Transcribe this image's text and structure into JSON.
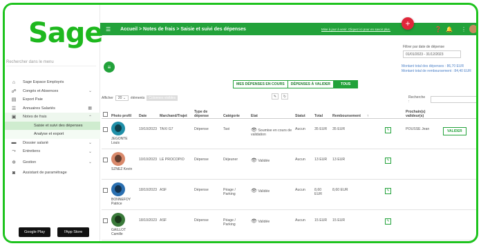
{
  "logo": "Sage",
  "sidebar": {
    "search_placeholder": "Rechercher dans le menu",
    "items": [
      {
        "label": "Sage Espace Employés",
        "icon": "⌂"
      },
      {
        "label": "Congés et Absences",
        "icon": "☍",
        "chev": "⌄"
      },
      {
        "label": "Export Paie",
        "icon": "▤"
      },
      {
        "label": "Annuaires Salariés",
        "icon": "☰",
        "chev": "▦"
      },
      {
        "label": "Notes de frais",
        "icon": "▣",
        "chev": "⌃"
      },
      {
        "label": "Saisie et suivi des dépenses"
      },
      {
        "label": "Analyse et export"
      },
      {
        "label": "Dossier salarié",
        "icon": "▬",
        "chev": "⌄"
      },
      {
        "label": "Entretiens",
        "icon": "⤳",
        "chev": "⌄"
      },
      {
        "label": "Gestion",
        "icon": "✲",
        "chev": "⌄"
      },
      {
        "label": "Assistant de paramétrage",
        "icon": "◙"
      }
    ],
    "google_play": "Google Play",
    "app_store": "l'App Store"
  },
  "topbar": {
    "breadcrumb": "Accueil > Notes de frais > Saisie et suivi des dépenses",
    "link": "Mise à jour à venir. Cliquez ici pour en savoir plus."
  },
  "filter": {
    "label": "Filtrer par date de dépense",
    "value": "01/01/2023 - 31/12/2023"
  },
  "totals": {
    "line1": "Montant total des dépenses : 86,70 EUR",
    "line2": "Montant total de remboursement : 84,40 EUR"
  },
  "tabs": {
    "mine": "MES DÉPENSES EN COURS",
    "to_validate": "DÉPENSES À VALIDER",
    "all": "TOUS"
  },
  "list": {
    "show_label": "Afficher",
    "show_value": "20",
    "elements": "éléments",
    "cols_button": "Colonnes visibles",
    "search_label": "Recherche :"
  },
  "columns": [
    "Photo profil",
    "Date",
    "Marchand/Trajet",
    "Type de dépense",
    "Catégorie",
    "Etat",
    "Statut",
    "Total",
    "Remboursement",
    "↑",
    "",
    "Prochain(s) valideur(s)",
    ""
  ],
  "rows": [
    {
      "name": "JEGONTE Louis",
      "date": "19/10/2023",
      "merchant": "TAXI G7",
      "type": "Dépense",
      "category": "Taxi",
      "state": "Soumise en cours de validation",
      "status": "Aucun",
      "total": "35 EUR",
      "refund": "35 EUR",
      "validator": "POUSSE Jean",
      "action": "VALIDER",
      "color": "#1f8fa8"
    },
    {
      "name": "SZNEZ Kevin",
      "date": "10/10/2023",
      "merchant": "LE PROCOPIO",
      "type": "Dépense",
      "category": "Déjeuner",
      "state": "Validée",
      "status": "Aucun",
      "total": "13 EUR",
      "refund": "13 EUR",
      "validator": "",
      "action": "",
      "color": "#d9896b"
    },
    {
      "name": "BONNEFOY Patrice",
      "date": "18/10/2023",
      "merchant": "ASF",
      "type": "Dépense",
      "category": "Péage / Parking",
      "state": "Validée",
      "status": "Aucun",
      "total": "8,60 EUR",
      "refund": "8,60 EUR",
      "validator": "",
      "action": "",
      "color": "#2a6fb0"
    },
    {
      "name": "GAILLOT Camille",
      "date": "18/10/2023",
      "merchant": "ASF",
      "type": "Dépense",
      "category": "Péage / Parking",
      "state": "Validée",
      "status": "Aucun",
      "total": "15 EUR",
      "refund": "15 EUR",
      "validator": "",
      "action": "",
      "color": "#3a7a3a"
    }
  ]
}
